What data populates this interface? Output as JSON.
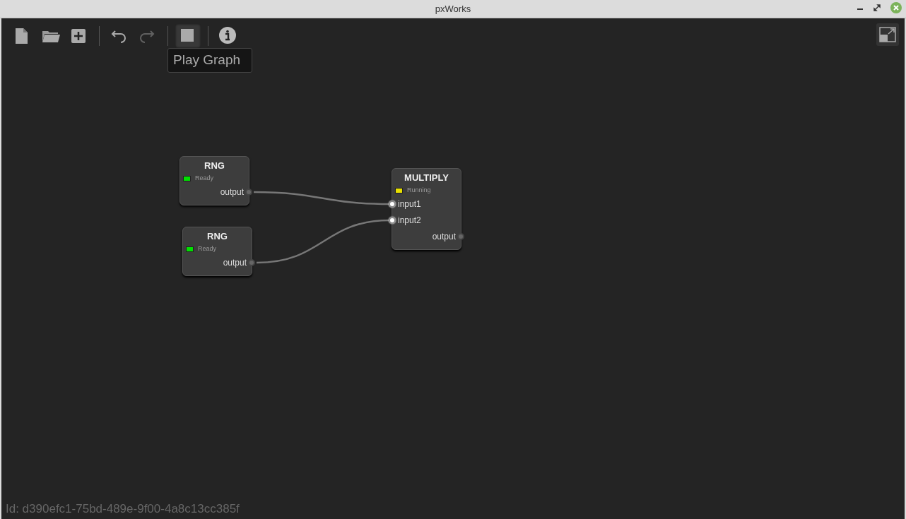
{
  "window": {
    "title": "pxWorks"
  },
  "toolbar": [
    {
      "kind": "new",
      "disabled": false
    },
    {
      "kind": "open",
      "disabled": false
    },
    {
      "kind": "add",
      "disabled": false
    },
    {
      "kind": "separator"
    },
    {
      "kind": "undo",
      "disabled": false
    },
    {
      "kind": "redo",
      "disabled": true
    },
    {
      "kind": "separator"
    },
    {
      "kind": "stop",
      "disabled": false,
      "hovered": true
    },
    {
      "kind": "separator"
    },
    {
      "kind": "info",
      "disabled": false
    }
  ],
  "tooltip": "Play Graph",
  "nodes": [
    {
      "title": "RNG",
      "status": "Ready",
      "color": "#00e000",
      "ports": [
        {
          "label": "output",
          "kind": "output"
        }
      ]
    },
    {
      "title": "RNG",
      "status": "Ready",
      "color": "#00e000",
      "ports": [
        {
          "label": "output",
          "kind": "output"
        }
      ]
    },
    {
      "title": "MULTIPLY",
      "status": "Running",
      "color": "#e8e000",
      "ports": [
        {
          "label": "input1",
          "kind": "input"
        },
        {
          "label": "input2",
          "kind": "input"
        },
        {
          "label": "output",
          "kind": "output"
        }
      ]
    }
  ],
  "footer": "Id: d390efc1-75bd-489e-9f00-4a8c13cc385f"
}
